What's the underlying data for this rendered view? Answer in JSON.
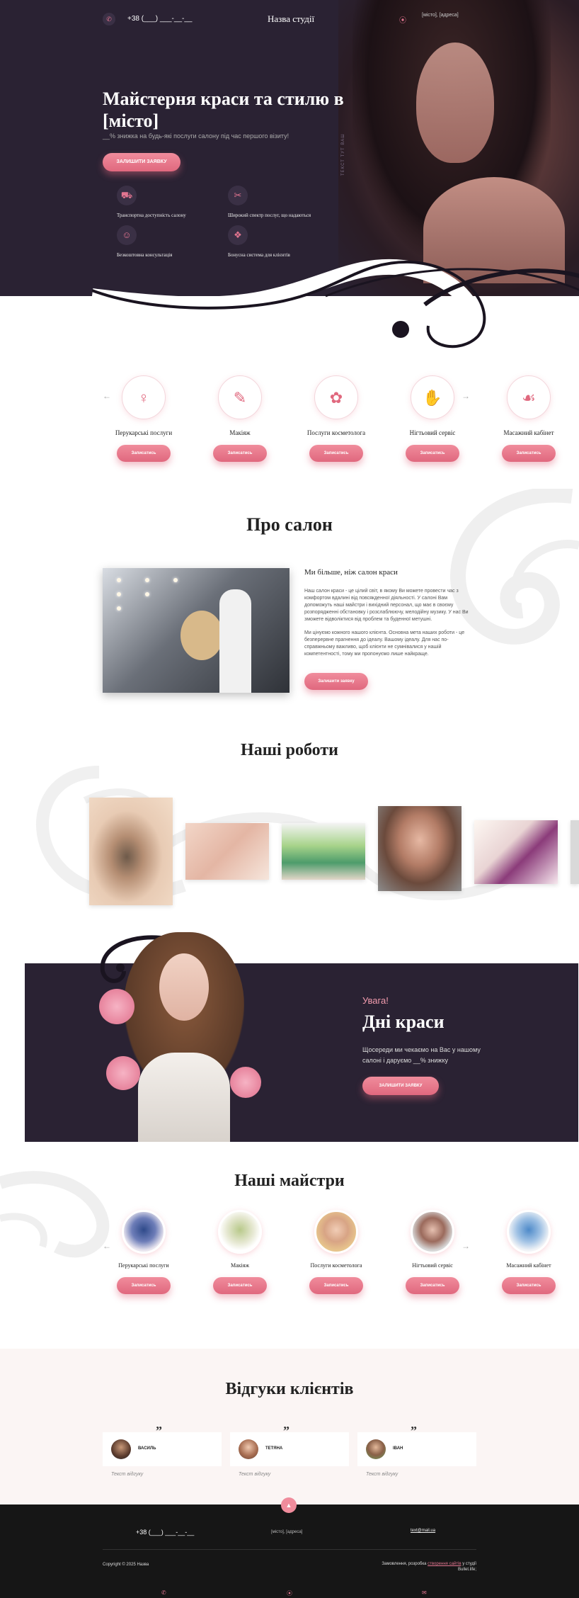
{
  "header": {
    "phone": "+38 (___) ___-__-__",
    "studio_name": "Назва студії",
    "address": "[місто], [адреса]"
  },
  "hero": {
    "title": "Майстерня краси та стилю в [місто]",
    "subtitle": "__% знижка на будь-які послуги салону під час першого візиту!",
    "cta": "ЗАЛИШИТИ ЗАЯВКУ",
    "vertical_text": "ТЕКСТ ТУТ ВАШ",
    "features": [
      {
        "icon": "car-icon",
        "label": "Транспортна доступність салону"
      },
      {
        "icon": "hairdryer-icon",
        "label": "Широкий спектр послуг, що надаються"
      },
      {
        "icon": "consultation-icon",
        "label": "Безкоштовна консультація"
      },
      {
        "icon": "gift-icon",
        "label": "Бонусна система для клієнтів"
      }
    ]
  },
  "services": {
    "button_label": "Записатись",
    "items": [
      {
        "label": "Перукарські послуги",
        "icon": "hair-icon"
      },
      {
        "label": "Макіяж",
        "icon": "makeup-icon"
      },
      {
        "label": "Послуги косметолога",
        "icon": "cosmetology-icon"
      },
      {
        "label": "Нігтьовий сервіс",
        "icon": "nail-polish-icon"
      },
      {
        "label": "Масажний кабінет",
        "icon": "massage-icon"
      }
    ]
  },
  "about": {
    "title": "Про салон",
    "subtitle": "Ми більше, ніж салон краси",
    "paragraph1": "Наш салон краси - це цілий світ, в якому Ви можете провести час з комфортом вдалині від повсякденної діяльності. У салоні Вам допоможуть наші майстри і вихідний персонал, що має в своєму розпорядженні обстановку і розслаблюючу, мелодійну музику. У нас Ви зможете відволіктися від проблем та буденної метушні.",
    "paragraph2": "Ми цінуємо кожного нашого клієнта. Основна мета наших роботи - це безперервне прагнення до ідеалу. Вашому ідеалу. Для нас по-справжньому важливо, щоб клієнти не сумнівалися у нашій компетентності, тому ми пропонуємо лише найкраще.",
    "button": "Залишити заявку"
  },
  "works": {
    "title": "Наші роботи"
  },
  "promo": {
    "kicker": "Увага!",
    "title": "Дні краси",
    "text": "Щосереди ми чекаємо на Вас у нашому салоні і даруємо __% знижку",
    "cta": "ЗАЛИШИТИ ЗАЯВКУ"
  },
  "masters": {
    "title": "Наші майстри",
    "button_label": "Записатись",
    "items": [
      {
        "label": "Перукарські послуги"
      },
      {
        "label": "Макіяж"
      },
      {
        "label": "Послуги косметолога"
      },
      {
        "label": "Нігтьовий сервіс"
      },
      {
        "label": "Масажний кабінет"
      }
    ]
  },
  "reviews": {
    "title": "Відгуки клієнтів",
    "items": [
      {
        "name": "ВАСИЛЬ",
        "text": "Текст відгуку"
      },
      {
        "name": "ТЕТЯНА",
        "text": "Текст відгуку"
      },
      {
        "name": "ІВАН",
        "text": "Текст відгуку"
      }
    ]
  },
  "footer": {
    "phone": "+38 (___) ___-__-__",
    "address": "[місто], [адреса]",
    "email": "text@mail.ua",
    "copyright": "Copyright © 2025 Назва",
    "made_prefix": "Замовлення, розробка",
    "made_link": "створення сайтів",
    "made_suffix": "у студії Bullet.life;"
  },
  "colors": {
    "accent": "#e0687e",
    "dark": "#2a2233",
    "footer": "#161616"
  }
}
